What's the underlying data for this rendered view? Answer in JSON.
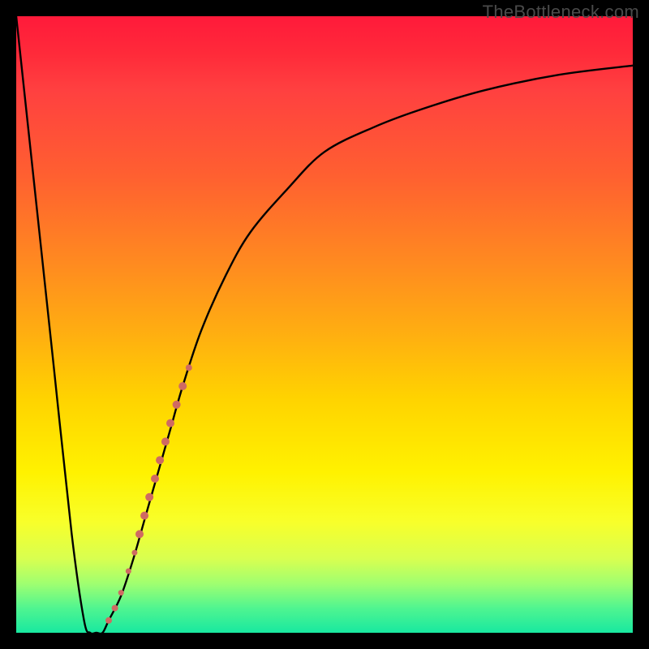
{
  "watermark": "TheBottleneck.com",
  "chart_data": {
    "type": "line",
    "title": "",
    "xlabel": "",
    "ylabel": "",
    "xlim": [
      0,
      100
    ],
    "ylim": [
      0,
      100
    ],
    "series": [
      {
        "name": "bottleneck-curve",
        "x": [
          0,
          3,
          6,
          9,
          11,
          12,
          13,
          14,
          15,
          17,
          19,
          21,
          23,
          25,
          27,
          30,
          34,
          38,
          44,
          50,
          58,
          66,
          76,
          88,
          100
        ],
        "values": [
          100,
          72,
          44,
          16,
          2,
          0,
          0,
          0,
          2,
          6,
          12,
          19,
          26,
          33,
          40,
          49,
          58,
          65,
          72,
          78,
          82,
          85,
          88,
          90.5,
          92
        ]
      }
    ],
    "highlight_cluster": {
      "name": "highlight-points",
      "color": "#cf6a62",
      "points": [
        {
          "x": 15.0,
          "y": 2.0,
          "r": 4
        },
        {
          "x": 16.0,
          "y": 4.0,
          "r": 4
        },
        {
          "x": 17.0,
          "y": 6.5,
          "r": 3.5
        },
        {
          "x": 18.2,
          "y": 10.0,
          "r": 3.5
        },
        {
          "x": 19.2,
          "y": 13.0,
          "r": 3.5
        },
        {
          "x": 20.0,
          "y": 16.0,
          "r": 5
        },
        {
          "x": 20.8,
          "y": 19.0,
          "r": 5
        },
        {
          "x": 21.6,
          "y": 22.0,
          "r": 5
        },
        {
          "x": 22.5,
          "y": 25.0,
          "r": 5
        },
        {
          "x": 23.3,
          "y": 28.0,
          "r": 5
        },
        {
          "x": 24.2,
          "y": 31.0,
          "r": 5
        },
        {
          "x": 25.0,
          "y": 34.0,
          "r": 5
        },
        {
          "x": 26.0,
          "y": 37.0,
          "r": 5
        },
        {
          "x": 27.0,
          "y": 40.0,
          "r": 5
        },
        {
          "x": 28.0,
          "y": 43.0,
          "r": 4
        }
      ]
    }
  }
}
